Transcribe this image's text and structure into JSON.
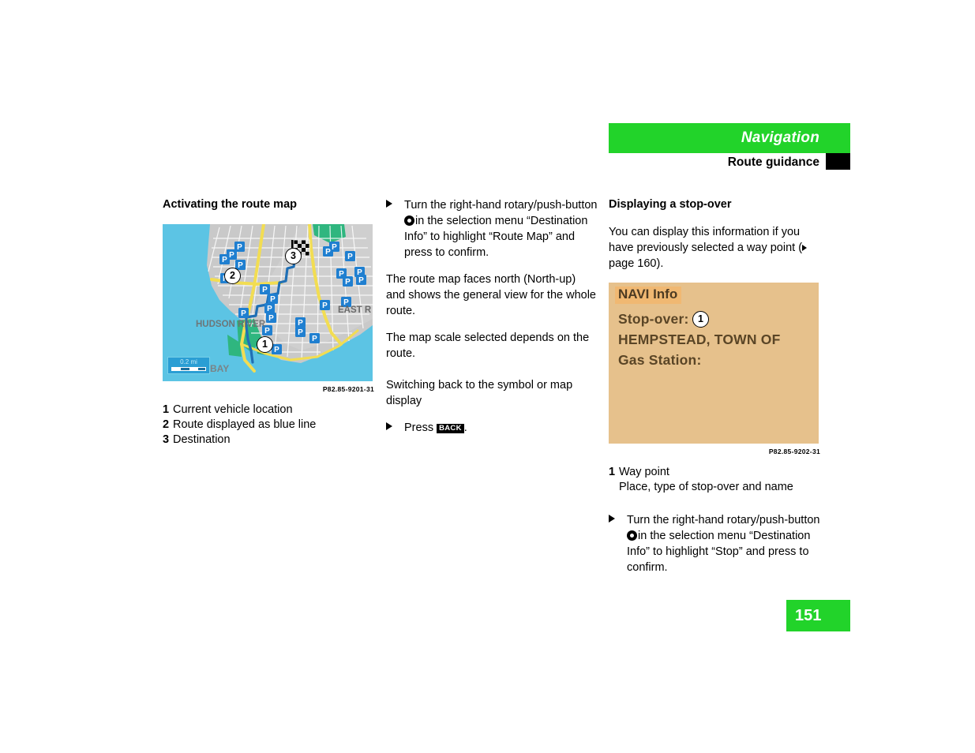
{
  "header": {
    "chapter": "Navigation",
    "section": "Route guidance",
    "tab_marker": "section-tab-marker"
  },
  "page_number": "151",
  "left_column": {
    "heading": "Activating the route map",
    "figure": {
      "code": "P82.85-9201-31",
      "scale_label": "0.2 mi",
      "map_labels": {
        "river": "HUDSON RIVER",
        "east_river": "EAST R",
        "bay": "BAY"
      },
      "callouts": [
        {
          "num": "1"
        },
        {
          "num": "2"
        },
        {
          "num": "3"
        }
      ],
      "poi_marker_letter": "P"
    },
    "legend": [
      {
        "num": "1",
        "text": "Current vehicle location"
      },
      {
        "num": "2",
        "text": "Route displayed as blue line"
      },
      {
        "num": "3",
        "text": "Destination"
      }
    ]
  },
  "middle_column": {
    "step_1": {
      "part_a": "Turn the right-hand rotary/push-button",
      "icon": "rotary-push-button-icon",
      "part_b": "in the selection menu “Destination Info” to highlight “Route Map” and press to confirm."
    },
    "paragraph_1": "The route map faces north (North-up) and shows the general view for the whole route.",
    "paragraph_2": "The map scale selected depends on the route.",
    "heading_2": "Switching back to the symbol or map display",
    "step_2": {
      "part_a": "Press",
      "key": "BACK",
      "part_b": "."
    }
  },
  "right_column": {
    "heading": "Displaying a stop-over",
    "paragraph_1_a": "You can display this information if you have previously selected a way point (",
    "paragraph_1_ref": "page 160",
    "paragraph_1_b": ").",
    "figure": {
      "code": "P82.85-9202-31",
      "screen_title": "NAVI Info",
      "line_1": "Stop-over:",
      "line_2": "HEMPSTEAD, TOWN OF",
      "line_3": "Gas Station:",
      "callout": "1"
    },
    "legend": [
      {
        "num": "1",
        "text": "Way point"
      }
    ],
    "legend_sub": "Place, type of stop-over and name",
    "step_1": {
      "part_a": "Turn the right-hand rotary/push-button",
      "icon": "rotary-push-button-icon",
      "part_b": "in the selection menu “Destination Info” to highlight “Stop” and press to confirm."
    }
  },
  "colors": {
    "chapter_green": "#22d32a",
    "navi_screen_bg": "#e6c18c",
    "navi_title_highlight": "#f0b872",
    "map_water": "#5cc4e4",
    "map_land": "#c7c7c7",
    "map_route_blue": "#1f6fb5",
    "map_poi_blue": "#1f7fd0",
    "map_road_yellow": "#f2dd52",
    "map_park_green": "#2fb67f"
  }
}
